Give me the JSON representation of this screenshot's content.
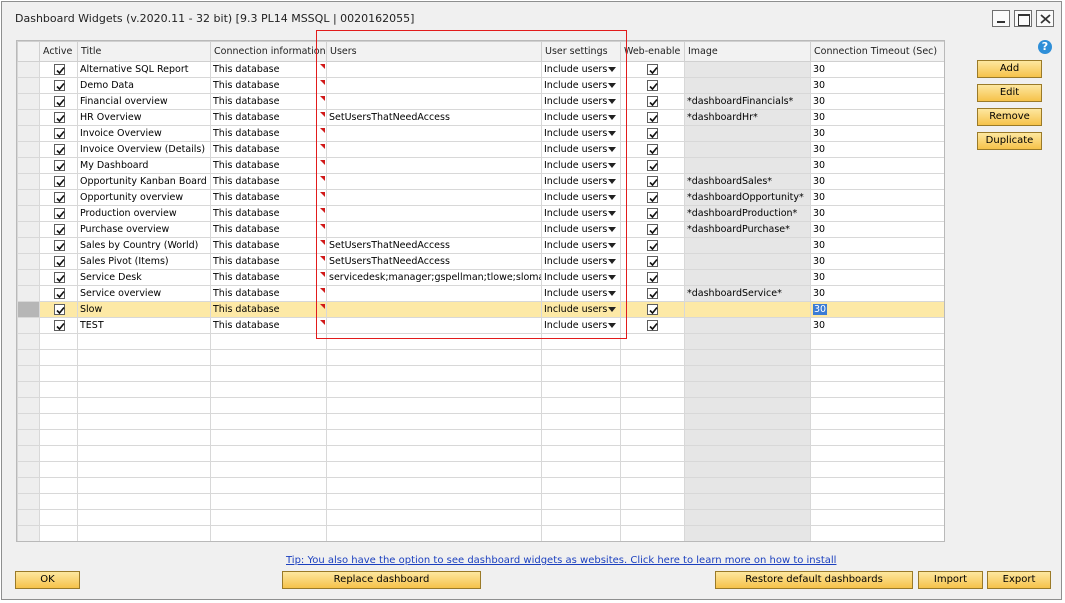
{
  "window": {
    "title": "Dashboard Widgets (v.2020.11 - 32 bit) [9.3 PL14 MSSQL | 0020162055]"
  },
  "grid": {
    "columns": [
      "Active",
      "Title",
      "Connection information",
      "Users",
      "User settings",
      "Web-enable",
      "Image",
      "Connection Timeout (Sec)"
    ],
    "rows": [
      {
        "active": true,
        "title": "Alternative SQL Report",
        "connection": "This database",
        "users": "",
        "user_settings": "Include users",
        "web": true,
        "image": "",
        "timeout": "30"
      },
      {
        "active": true,
        "title": "Demo Data",
        "connection": "This database",
        "users": "",
        "user_settings": "Include users",
        "web": true,
        "image": "",
        "timeout": "30"
      },
      {
        "active": true,
        "title": "Financial overview",
        "connection": "This database",
        "users": "",
        "user_settings": "Include users",
        "web": true,
        "image": "*dashboardFinancials*",
        "timeout": "30"
      },
      {
        "active": true,
        "title": "HR Overview",
        "connection": "This database",
        "users": "SetUsersThatNeedAccess",
        "user_settings": "Include users",
        "web": true,
        "image": "*dashboardHr*",
        "timeout": "30"
      },
      {
        "active": true,
        "title": "Invoice Overview",
        "connection": "This database",
        "users": "",
        "user_settings": "Include users",
        "web": true,
        "image": "",
        "timeout": "30"
      },
      {
        "active": true,
        "title": "Invoice Overview (Details)",
        "connection": "This database",
        "users": "",
        "user_settings": "Include users",
        "web": true,
        "image": "",
        "timeout": "30"
      },
      {
        "active": true,
        "title": "My Dashboard",
        "connection": "This database",
        "users": "",
        "user_settings": "Include users",
        "web": true,
        "image": "",
        "timeout": "30"
      },
      {
        "active": true,
        "title": "Opportunity Kanban Board",
        "connection": "This database",
        "users": "",
        "user_settings": "Include users",
        "web": true,
        "image": "*dashboardSales*",
        "timeout": "30"
      },
      {
        "active": true,
        "title": "Opportunity overview",
        "connection": "This database",
        "users": "",
        "user_settings": "Include users",
        "web": true,
        "image": "*dashboardOpportunity*",
        "timeout": "30"
      },
      {
        "active": true,
        "title": "Production overview",
        "connection": "This database",
        "users": "",
        "user_settings": "Include users",
        "web": true,
        "image": "*dashboardProduction*",
        "timeout": "30"
      },
      {
        "active": true,
        "title": "Purchase overview",
        "connection": "This database",
        "users": "",
        "user_settings": "Include users",
        "web": true,
        "image": "*dashboardPurchase*",
        "timeout": "30"
      },
      {
        "active": true,
        "title": "Sales by Country (World)",
        "connection": "This database",
        "users": "SetUsersThatNeedAccess",
        "user_settings": "Include users",
        "web": true,
        "image": "",
        "timeout": "30"
      },
      {
        "active": true,
        "title": "Sales Pivot (Items)",
        "connection": "This database",
        "users": "SetUsersThatNeedAccess",
        "user_settings": "Include users",
        "web": true,
        "image": "",
        "timeout": "30"
      },
      {
        "active": true,
        "title": "Service Desk",
        "connection": "This database",
        "users": "servicedesk;manager;gspellman;tlowe;slomax",
        "user_settings": "Include users",
        "web": true,
        "image": "",
        "timeout": "30"
      },
      {
        "active": true,
        "title": "Service overview",
        "connection": "This database",
        "users": "",
        "user_settings": "Include users",
        "web": true,
        "image": "*dashboardService*",
        "timeout": "30"
      },
      {
        "active": true,
        "title": "Slow",
        "connection": "This database",
        "users": "",
        "user_settings": "Include users",
        "web": true,
        "image": "",
        "timeout": "30",
        "selected": true
      },
      {
        "active": true,
        "title": "TEST",
        "connection": "This database",
        "users": "",
        "user_settings": "Include users",
        "web": true,
        "image": "",
        "timeout": "30"
      }
    ],
    "empty_rows": 13
  },
  "side_buttons": {
    "add": "Add",
    "edit": "Edit",
    "remove": "Remove",
    "duplicate": "Duplicate"
  },
  "footer": {
    "tip": "Tip: You also have the option to see dashboard widgets as websites. Click here to learn more on how to install",
    "ok": "OK",
    "replace": "Replace dashboard",
    "restore": "Restore default dashboards",
    "import": "Import",
    "export": "Export"
  },
  "icons": {
    "help": "help-icon",
    "dropdown": "chevron-down-icon",
    "checkbox": "checkmark-icon"
  },
  "colors": {
    "selected_row": "#fde9a6",
    "button": "#f6c24a",
    "highlight_box": "#e21b1b",
    "link": "#1a3fbf"
  }
}
